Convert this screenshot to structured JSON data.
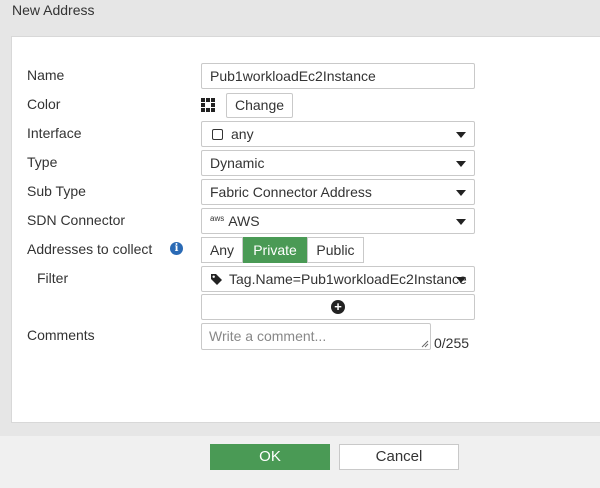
{
  "dialog": {
    "title": "New Address"
  },
  "form": {
    "name": {
      "label": "Name",
      "value": "Pub1workloadEc2Instance"
    },
    "color": {
      "label": "Color",
      "change_label": "Change"
    },
    "interface": {
      "label": "Interface",
      "value": "any"
    },
    "type": {
      "label": "Type",
      "value": "Dynamic"
    },
    "sub_type": {
      "label": "Sub Type",
      "value": "Fabric Connector Address"
    },
    "sdn_connector": {
      "label": "SDN Connector",
      "icon_text": "aws",
      "value": "AWS"
    },
    "addresses_to_collect": {
      "label": "Addresses to collect",
      "options": [
        "Any",
        "Private",
        "Public"
      ],
      "selected": "Private"
    },
    "filter": {
      "label": "Filter",
      "value": "Tag.Name=Pub1workloadEc2Instance"
    },
    "comments": {
      "label": "Comments",
      "placeholder": "Write a comment...",
      "counter": "0/255"
    }
  },
  "footer": {
    "ok_label": "OK",
    "cancel_label": "Cancel"
  },
  "colors": {
    "accent": "#4a9a55",
    "info": "#2a6ab5"
  }
}
